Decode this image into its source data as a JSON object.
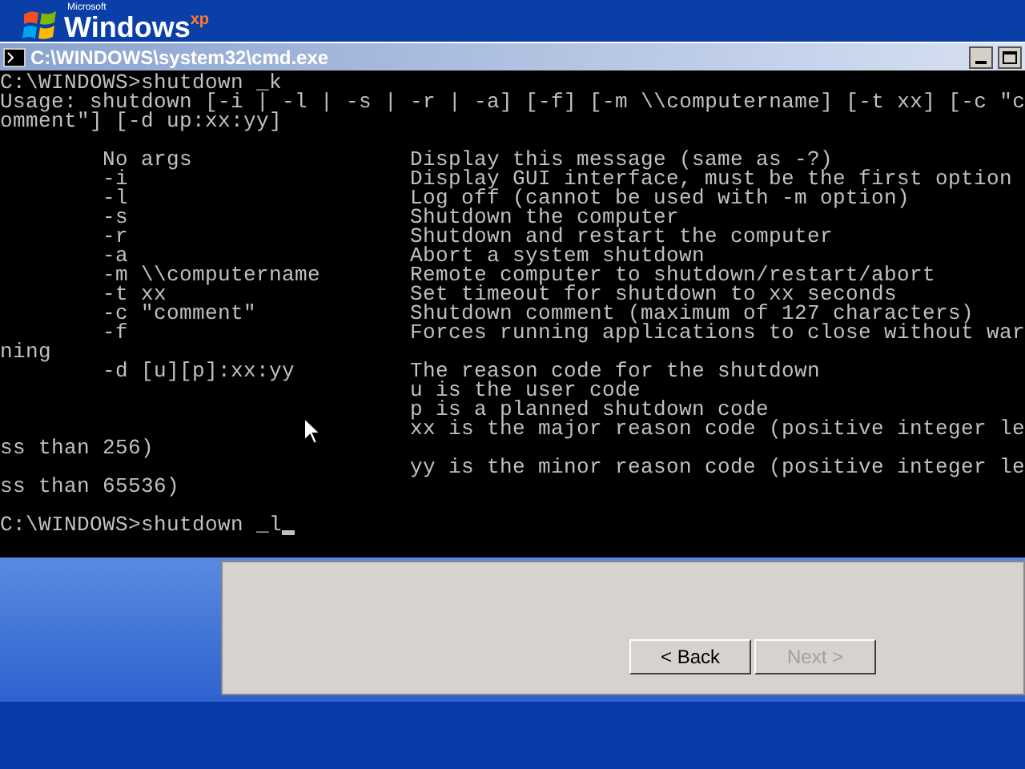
{
  "desktop": {
    "logo": {
      "brand": "Microsoft",
      "name": "Windows",
      "edition": "xp"
    }
  },
  "window": {
    "title": "C:\\WINDOWS\\system32\\cmd.exe"
  },
  "console": {
    "lines": [
      {
        "kind": "text",
        "text": "C:\\WINDOWS>shutdown _k"
      },
      {
        "kind": "text",
        "text": "Usage: shutdown [-i | -l | -s | -r | -a] [-f] [-m \\\\computername] [-t xx] [-c \"c"
      },
      {
        "kind": "text",
        "text": "omment\"] [-d up:xx:yy]"
      },
      {
        "kind": "blank"
      },
      {
        "kind": "option",
        "option": "No args",
        "description": "Display this message (same as -?)"
      },
      {
        "kind": "option",
        "option": "-i",
        "description": "Display GUI interface, must be the first option"
      },
      {
        "kind": "option",
        "option": "-l",
        "description": "Log off (cannot be used with -m option)"
      },
      {
        "kind": "option",
        "option": "-s",
        "description": "Shutdown the computer"
      },
      {
        "kind": "option",
        "option": "-r",
        "description": "Shutdown and restart the computer"
      },
      {
        "kind": "option",
        "option": "-a",
        "description": "Abort a system shutdown"
      },
      {
        "kind": "option",
        "option": "-m \\\\computername",
        "description": "Remote computer to shutdown/restart/abort"
      },
      {
        "kind": "option",
        "option": "-t xx",
        "description": "Set timeout for shutdown to xx seconds"
      },
      {
        "kind": "option",
        "option": "-c \"comment\"",
        "description": "Shutdown comment (maximum of 127 characters)"
      },
      {
        "kind": "option",
        "option": "-f",
        "description": "Forces running applications to close without war"
      },
      {
        "kind": "text",
        "text": "ning"
      },
      {
        "kind": "option",
        "option": "-d [u][p]:xx:yy",
        "description": "The reason code for the shutdown"
      },
      {
        "kind": "detail",
        "description": "u is the user code"
      },
      {
        "kind": "detail",
        "description": "p is a planned shutdown code"
      },
      {
        "kind": "detail",
        "description": "xx is the major reason code (positive integer le"
      },
      {
        "kind": "text",
        "text": "ss than 256)"
      },
      {
        "kind": "detail",
        "description": "yy is the minor reason code (positive integer le"
      },
      {
        "kind": "text",
        "text": "ss than 65536)"
      },
      {
        "kind": "blank"
      },
      {
        "kind": "prompt",
        "text": "C:\\WINDOWS>shutdown _l"
      }
    ]
  },
  "wizard": {
    "buttons": [
      {
        "label": "< Back",
        "disabled": false
      },
      {
        "label": "Next >",
        "disabled": true
      }
    ]
  }
}
